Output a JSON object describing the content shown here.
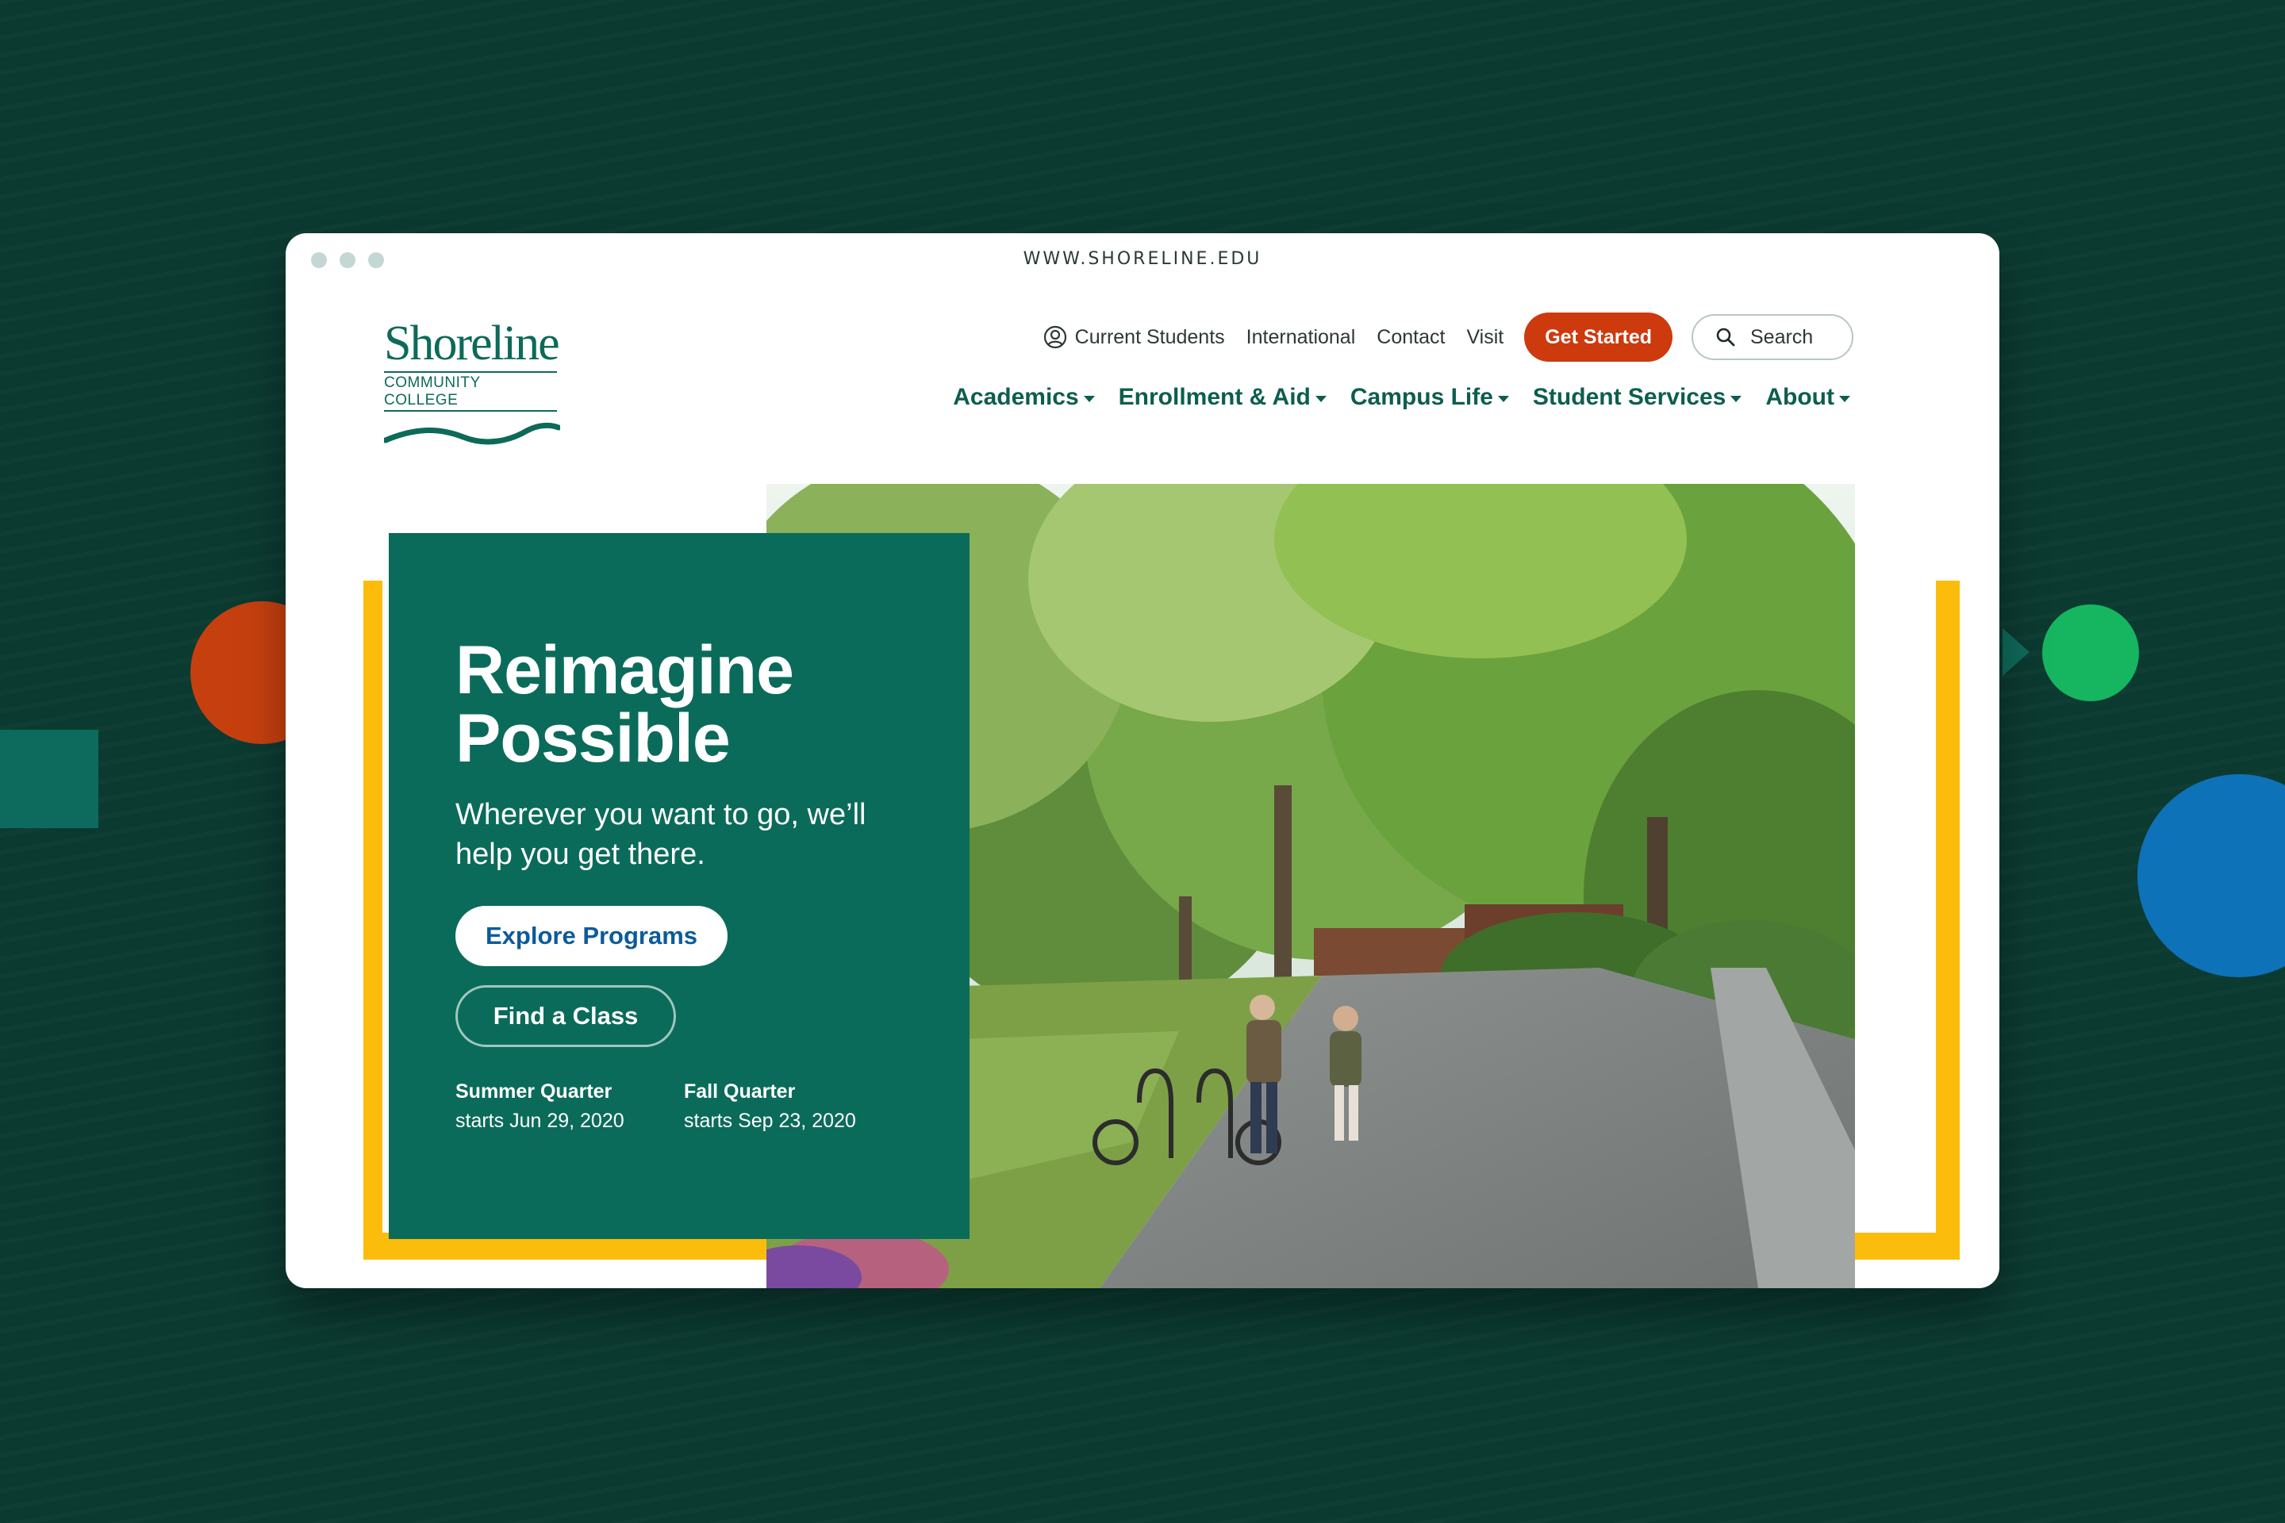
{
  "browser": {
    "url": "WWW.SHORELINE.EDU"
  },
  "logo": {
    "name": "Shoreline",
    "subtitle": "COMMUNITY COLLEGE"
  },
  "utility_nav": {
    "current_students": "Current Students",
    "international": "International",
    "contact": "Contact",
    "visit": "Visit",
    "get_started": "Get Started",
    "search": "Search"
  },
  "main_nav": [
    {
      "label": "Academics"
    },
    {
      "label": "Enrollment & Aid"
    },
    {
      "label": "Campus Life"
    },
    {
      "label": "Student Services"
    },
    {
      "label": "About"
    }
  ],
  "hero": {
    "title_line1": "Reimagine",
    "title_line2": "Possible",
    "subtitle": "Wherever you want to go, we’ll help you get there.",
    "explore_label": "Explore Programs",
    "find_class_label": "Find a Class",
    "quarters": [
      {
        "name": "Summer Quarter",
        "date": "starts Jun 29, 2020"
      },
      {
        "name": "Fall Quarter",
        "date": "starts Sep 23, 2020"
      }
    ]
  },
  "colors": {
    "background": "#0b3a31",
    "brand_green": "#0b6b5a",
    "accent_orange": "#cc3a0e",
    "accent_yellow": "#fbbc0c",
    "link_blue": "#0b5b9a"
  },
  "icons": {
    "user": "user-circle-icon",
    "search": "search-icon",
    "caret": "caret-down-icon"
  }
}
